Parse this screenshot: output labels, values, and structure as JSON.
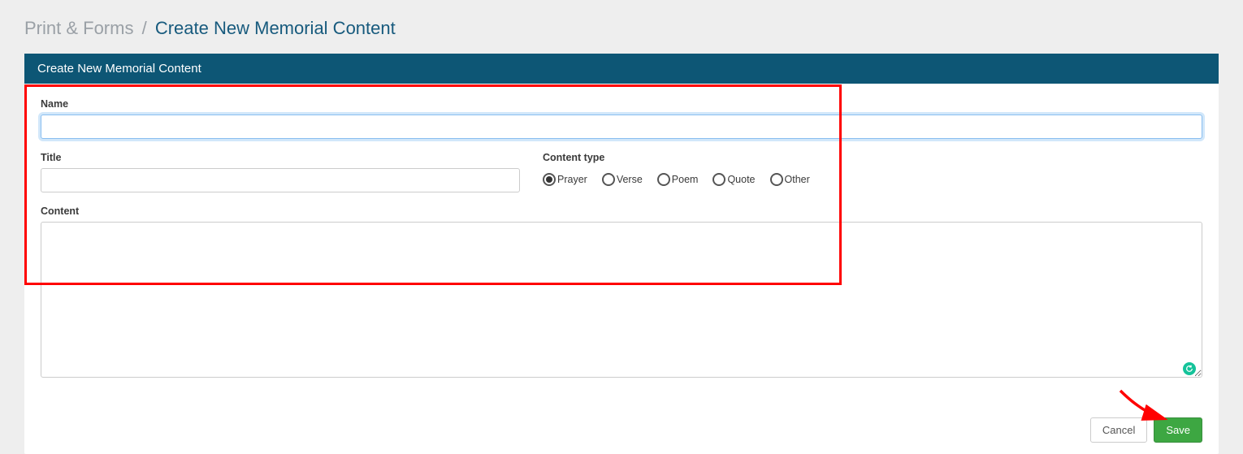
{
  "breadcrumb": {
    "parent": "Print & Forms",
    "separator": "/",
    "current": "Create New Memorial Content"
  },
  "panel": {
    "title": "Create New Memorial Content"
  },
  "form": {
    "name": {
      "label": "Name",
      "value": ""
    },
    "title": {
      "label": "Title",
      "value": ""
    },
    "content_type": {
      "label": "Content type",
      "options": [
        {
          "label": "Prayer",
          "selected": true
        },
        {
          "label": "Verse",
          "selected": false
        },
        {
          "label": "Poem",
          "selected": false
        },
        {
          "label": "Quote",
          "selected": false
        },
        {
          "label": "Other",
          "selected": false
        }
      ]
    },
    "content": {
      "label": "Content",
      "value": ""
    }
  },
  "buttons": {
    "cancel": "Cancel",
    "save": "Save"
  }
}
